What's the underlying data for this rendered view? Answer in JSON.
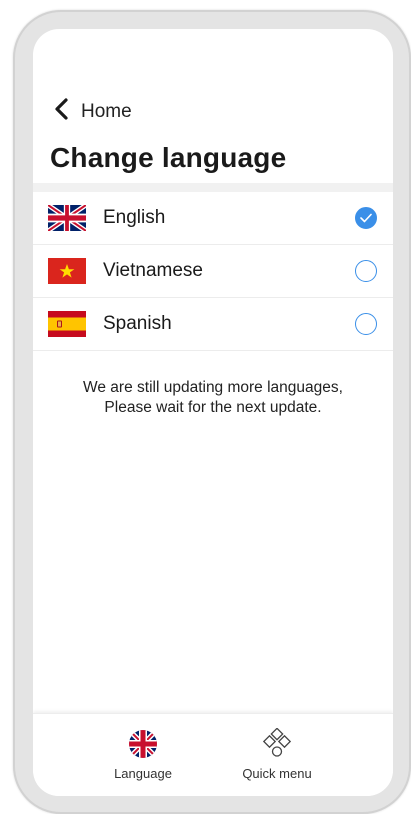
{
  "header": {
    "back_label": "Home",
    "title": "Change language"
  },
  "languages": [
    {
      "name": "English",
      "flag": "uk-flag-icon",
      "selected": true
    },
    {
      "name": "Vietnamese",
      "flag": "vietnam-flag-icon",
      "selected": false
    },
    {
      "name": "Spanish",
      "flag": "spain-flag-icon",
      "selected": false
    }
  ],
  "notice": {
    "line1": "We are still updating more languages,",
    "line2": "Please wait for the next update."
  },
  "bottom_nav": {
    "items": [
      {
        "label": "Language",
        "icon": "uk-flag-round-icon"
      },
      {
        "label": "Quick menu",
        "icon": "quick-menu-icon"
      }
    ]
  },
  "colors": {
    "accent": "#3a8fe8",
    "frame": "#e4e4e4"
  }
}
